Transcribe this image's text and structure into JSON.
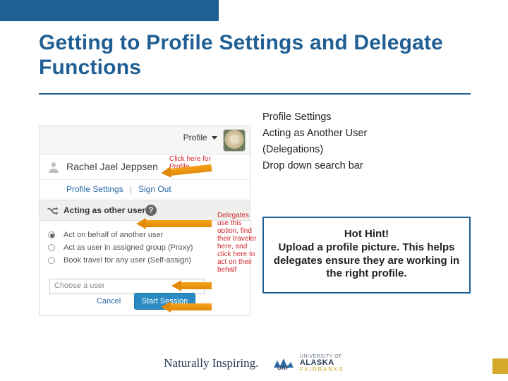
{
  "title": "Getting to Profile Settings and Delegate Functions",
  "bullets": [
    "Profile Settings",
    "Acting as Another User",
    "(Delegations)",
    "Drop down search bar"
  ],
  "hint": {
    "title": "Hot Hint!",
    "body": "Upload a profile picture. This helps delegates ensure they are working in the right profile."
  },
  "shot": {
    "profile_tab": "Profile",
    "user_name": "Rachel Jael Jeppsen",
    "link_profile_settings": "Profile Settings",
    "link_sign_out": "Sign Out",
    "section_label": "Acting as other user",
    "help_glyph": "?",
    "options": [
      "Act on behalf of another user",
      "Act as user in assigned group (Proxy)",
      "Book travel for any user (Self-assign)"
    ],
    "choose_placeholder": "Choose a user",
    "btn_cancel": "Cancel",
    "btn_start": "Start Session"
  },
  "callouts": {
    "c1": "Click here for Profile",
    "c2": "Delegates use this option, find their traveler here, and click here to act on their behalf"
  },
  "footer": {
    "tagline": "Naturally Inspiring.",
    "logo_small": "UNIVERSITY OF",
    "logo_main": "ALASKA",
    "logo_campus": "FAIRBANKS",
    "logo_abbrev": "UAF"
  }
}
